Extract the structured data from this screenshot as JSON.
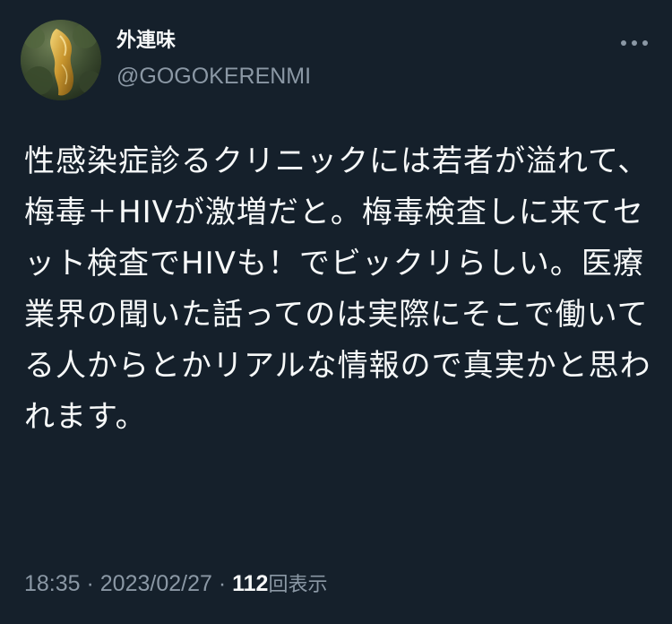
{
  "tweet": {
    "display_name": "外連味",
    "username": "@GOGOKERENMI",
    "text": "性感染症診るクリニックには若者が溢れて、梅毒＋HIVが激増だと。梅毒検査しに来てセット検査でHIVも！でビックリらしい。医療業界の聞いた話ってのは実際にそこで働いてる人からとかリアルな情報ので真実かと思われます。",
    "time": "18:35",
    "separator": " · ",
    "date": "2023/02/27",
    "views_count": "112",
    "views_label": "回表示"
  },
  "icons": {
    "avatar": "profile-photo-gold-statue",
    "more": "more-horizontal-icon"
  },
  "colors": {
    "background": "#15202b",
    "primary_text": "#f7f9f9",
    "secondary_text": "#8b98a5"
  }
}
